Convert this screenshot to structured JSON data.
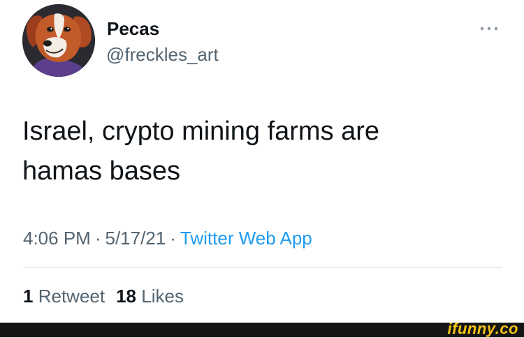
{
  "author": {
    "display_name": "Pecas",
    "handle": "@freckles_art",
    "avatar_icon": "fox-character-avatar"
  },
  "menu_icon": "more-horizontal-icon",
  "tweet": {
    "lines": [
      "Israel, crypto mining farms are",
      "hamas bases"
    ]
  },
  "meta": {
    "time": "4:06 PM",
    "separator": "·",
    "date": "5/17/21",
    "source": "Twitter Web App"
  },
  "stats": {
    "retweets_count": "1",
    "retweets_label": "Retweet",
    "likes_count": "18",
    "likes_label": "Likes"
  },
  "watermark": {
    "text": "ifunny.co"
  },
  "colors": {
    "text_primary": "#0f1419",
    "text_secondary": "#536471",
    "link": "#1d9bf0",
    "divider": "#cfd9de",
    "watermark": "#f4c114",
    "footer": "#151515"
  }
}
